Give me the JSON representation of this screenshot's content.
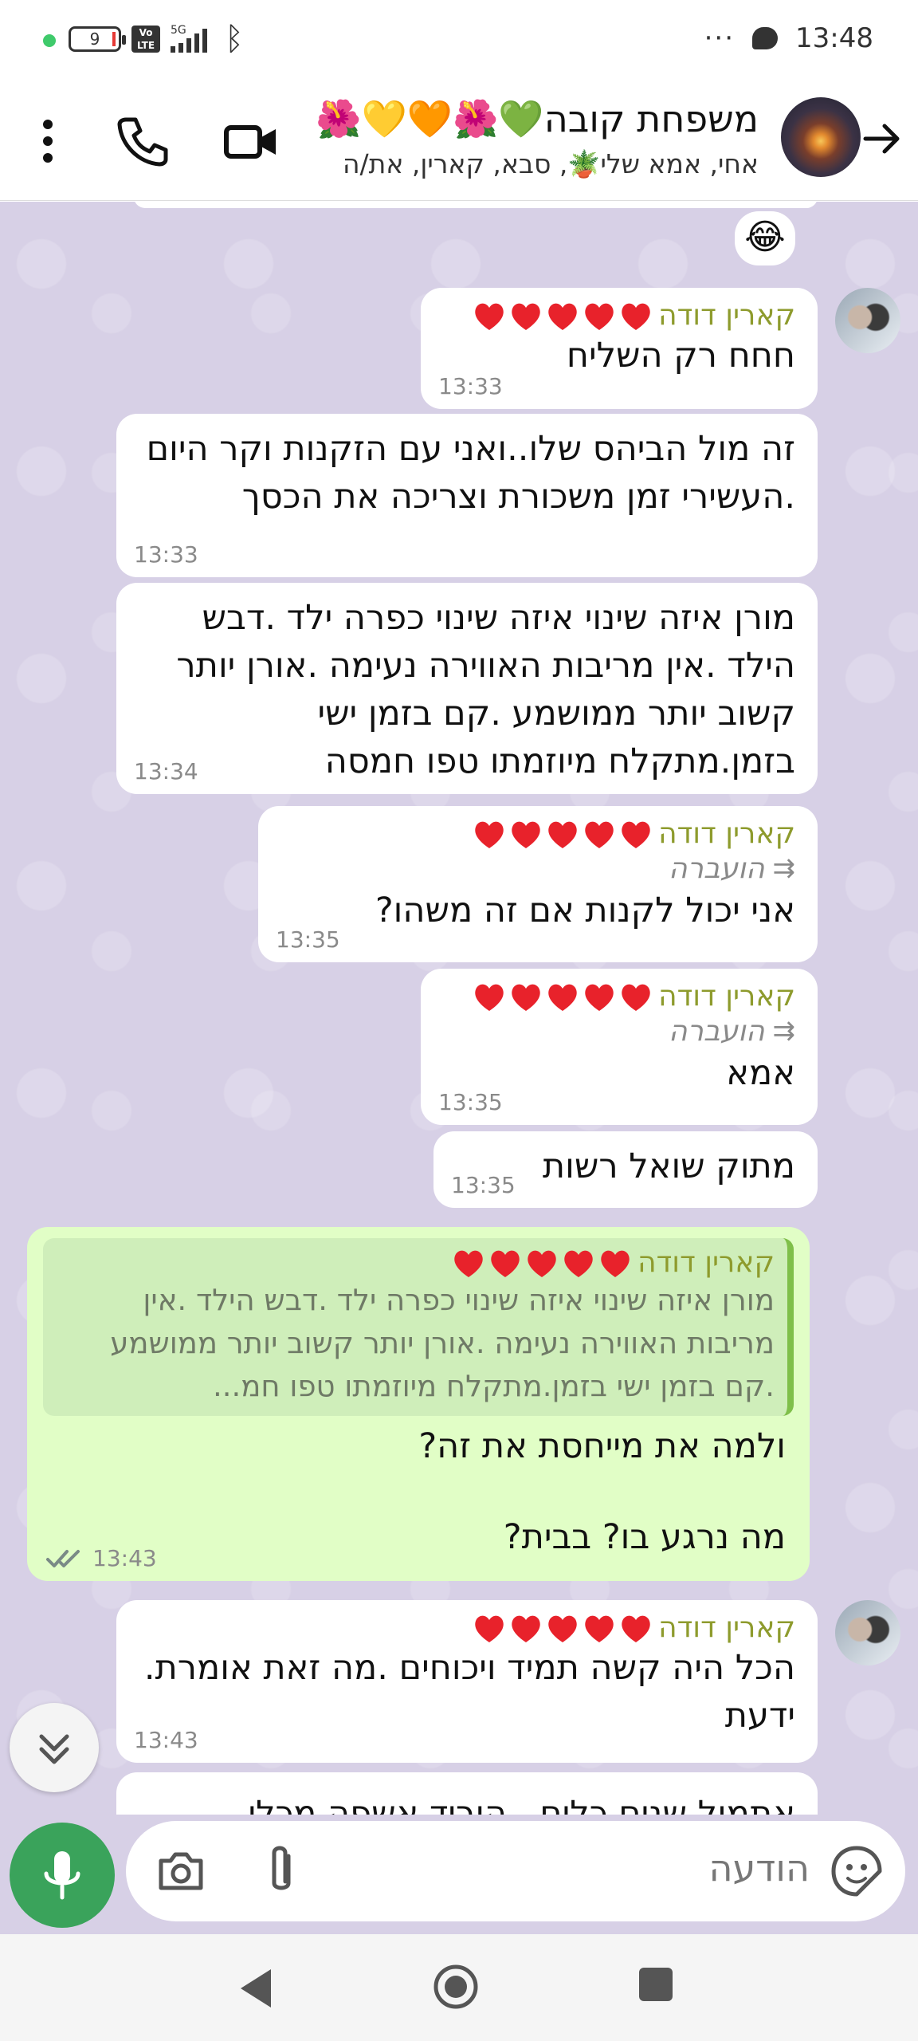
{
  "status_bar": {
    "battery_level": "9",
    "volte_label": "Vo LTE",
    "network_label": "5G",
    "time": "13:48"
  },
  "header": {
    "title": "משפחת קובה💚🌺🧡💛🌺",
    "subtitle": "אחי, אמא שלי🪴, סבא, קארין, את/ה",
    "icons": [
      "back-arrow-icon",
      "video-icon",
      "phone-icon",
      "more-vert-icon"
    ]
  },
  "messages": [
    {
      "reaction": "😂"
    },
    {
      "sender": "קארין דודה",
      "hearts": 5,
      "text": "חחח רק השליח",
      "time": "13:33"
    },
    {
      "text": "זה מול הביהס שלו..ואני עם הזקנות וקר היום .העשירי זמן משכורת וצריכה את הכסך",
      "time": "13:33"
    },
    {
      "text": "מורן איזה שינוי איזה שינוי כפרה ילד .דבש הילד .אין מריבות האווירה נעימה .אורן יותר קשוב יותר ממושמע .קם בזמן ישי בזמן.מתקלח מיוזמתו טפו חמסה",
      "time": "13:34"
    },
    {
      "sender": "קארין דודה",
      "hearts": 5,
      "forwarded": "הועברה",
      "text": "אני יכול לקנות אם זה משהו?",
      "time": "13:35"
    },
    {
      "sender": "קארין דודה",
      "hearts": 5,
      "forwarded": "הועברה",
      "text": "אמא",
      "time": "13:35"
    },
    {
      "text": "מתוק שואל רשות",
      "time": "13:35"
    },
    {
      "outgoing": true,
      "quote_sender": "קארין דודה",
      "quote_text": "מורן איזה שינוי איזה שינוי כפרה ילד .דבש הילד .אין מריבות האווירה נעימה .אורן יותר קשוב יותר ממושמע .קם בזמן ישי בזמן.מתקלח מיוזמתו טפו חמ...",
      "text_line1": "ולמה את מייחסת את זה?",
      "text_line2": "מה נרגע בו? בבית?",
      "time": "13:43",
      "status": "read"
    },
    {
      "sender": "קארין דודה",
      "hearts": 5,
      "text": "הכל היה קשה תמיד ויכוחים .מה זאת אומרת. ידעת",
      "time": "13:43"
    },
    {
      "text": "אתמול שנים כלים , הוריד אשפה מכלי"
    }
  ],
  "input": {
    "placeholder": "הודעה",
    "icons": [
      "sticker-icon",
      "attach-icon",
      "camera-icon",
      "mic-icon"
    ]
  },
  "colors": {
    "chat_background": "#d7d0e6",
    "incoming_bubble": "#ffffff",
    "outgoing_bubble": "#e1fec6",
    "sender_name": "#8e9b2d",
    "mic_button": "#3aa35b"
  }
}
